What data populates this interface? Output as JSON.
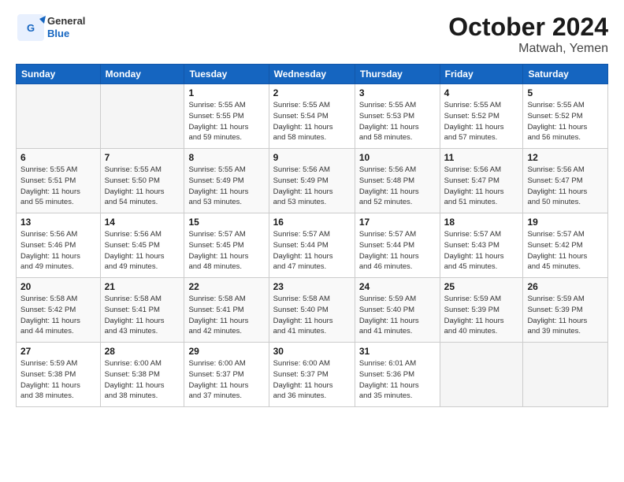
{
  "header": {
    "logo_general": "General",
    "logo_blue": "Blue",
    "month": "October 2024",
    "location": "Matwah, Yemen"
  },
  "weekdays": [
    "Sunday",
    "Monday",
    "Tuesday",
    "Wednesday",
    "Thursday",
    "Friday",
    "Saturday"
  ],
  "weeks": [
    [
      {
        "day": "",
        "info": ""
      },
      {
        "day": "",
        "info": ""
      },
      {
        "day": "1",
        "info": "Sunrise: 5:55 AM\nSunset: 5:55 PM\nDaylight: 11 hours\nand 59 minutes."
      },
      {
        "day": "2",
        "info": "Sunrise: 5:55 AM\nSunset: 5:54 PM\nDaylight: 11 hours\nand 58 minutes."
      },
      {
        "day": "3",
        "info": "Sunrise: 5:55 AM\nSunset: 5:53 PM\nDaylight: 11 hours\nand 58 minutes."
      },
      {
        "day": "4",
        "info": "Sunrise: 5:55 AM\nSunset: 5:52 PM\nDaylight: 11 hours\nand 57 minutes."
      },
      {
        "day": "5",
        "info": "Sunrise: 5:55 AM\nSunset: 5:52 PM\nDaylight: 11 hours\nand 56 minutes."
      }
    ],
    [
      {
        "day": "6",
        "info": "Sunrise: 5:55 AM\nSunset: 5:51 PM\nDaylight: 11 hours\nand 55 minutes."
      },
      {
        "day": "7",
        "info": "Sunrise: 5:55 AM\nSunset: 5:50 PM\nDaylight: 11 hours\nand 54 minutes."
      },
      {
        "day": "8",
        "info": "Sunrise: 5:55 AM\nSunset: 5:49 PM\nDaylight: 11 hours\nand 53 minutes."
      },
      {
        "day": "9",
        "info": "Sunrise: 5:56 AM\nSunset: 5:49 PM\nDaylight: 11 hours\nand 53 minutes."
      },
      {
        "day": "10",
        "info": "Sunrise: 5:56 AM\nSunset: 5:48 PM\nDaylight: 11 hours\nand 52 minutes."
      },
      {
        "day": "11",
        "info": "Sunrise: 5:56 AM\nSunset: 5:47 PM\nDaylight: 11 hours\nand 51 minutes."
      },
      {
        "day": "12",
        "info": "Sunrise: 5:56 AM\nSunset: 5:47 PM\nDaylight: 11 hours\nand 50 minutes."
      }
    ],
    [
      {
        "day": "13",
        "info": "Sunrise: 5:56 AM\nSunset: 5:46 PM\nDaylight: 11 hours\nand 49 minutes."
      },
      {
        "day": "14",
        "info": "Sunrise: 5:56 AM\nSunset: 5:45 PM\nDaylight: 11 hours\nand 49 minutes."
      },
      {
        "day": "15",
        "info": "Sunrise: 5:57 AM\nSunset: 5:45 PM\nDaylight: 11 hours\nand 48 minutes."
      },
      {
        "day": "16",
        "info": "Sunrise: 5:57 AM\nSunset: 5:44 PM\nDaylight: 11 hours\nand 47 minutes."
      },
      {
        "day": "17",
        "info": "Sunrise: 5:57 AM\nSunset: 5:44 PM\nDaylight: 11 hours\nand 46 minutes."
      },
      {
        "day": "18",
        "info": "Sunrise: 5:57 AM\nSunset: 5:43 PM\nDaylight: 11 hours\nand 45 minutes."
      },
      {
        "day": "19",
        "info": "Sunrise: 5:57 AM\nSunset: 5:42 PM\nDaylight: 11 hours\nand 45 minutes."
      }
    ],
    [
      {
        "day": "20",
        "info": "Sunrise: 5:58 AM\nSunset: 5:42 PM\nDaylight: 11 hours\nand 44 minutes."
      },
      {
        "day": "21",
        "info": "Sunrise: 5:58 AM\nSunset: 5:41 PM\nDaylight: 11 hours\nand 43 minutes."
      },
      {
        "day": "22",
        "info": "Sunrise: 5:58 AM\nSunset: 5:41 PM\nDaylight: 11 hours\nand 42 minutes."
      },
      {
        "day": "23",
        "info": "Sunrise: 5:58 AM\nSunset: 5:40 PM\nDaylight: 11 hours\nand 41 minutes."
      },
      {
        "day": "24",
        "info": "Sunrise: 5:59 AM\nSunset: 5:40 PM\nDaylight: 11 hours\nand 41 minutes."
      },
      {
        "day": "25",
        "info": "Sunrise: 5:59 AM\nSunset: 5:39 PM\nDaylight: 11 hours\nand 40 minutes."
      },
      {
        "day": "26",
        "info": "Sunrise: 5:59 AM\nSunset: 5:39 PM\nDaylight: 11 hours\nand 39 minutes."
      }
    ],
    [
      {
        "day": "27",
        "info": "Sunrise: 5:59 AM\nSunset: 5:38 PM\nDaylight: 11 hours\nand 38 minutes."
      },
      {
        "day": "28",
        "info": "Sunrise: 6:00 AM\nSunset: 5:38 PM\nDaylight: 11 hours\nand 38 minutes."
      },
      {
        "day": "29",
        "info": "Sunrise: 6:00 AM\nSunset: 5:37 PM\nDaylight: 11 hours\nand 37 minutes."
      },
      {
        "day": "30",
        "info": "Sunrise: 6:00 AM\nSunset: 5:37 PM\nDaylight: 11 hours\nand 36 minutes."
      },
      {
        "day": "31",
        "info": "Sunrise: 6:01 AM\nSunset: 5:36 PM\nDaylight: 11 hours\nand 35 minutes."
      },
      {
        "day": "",
        "info": ""
      },
      {
        "day": "",
        "info": ""
      }
    ]
  ]
}
